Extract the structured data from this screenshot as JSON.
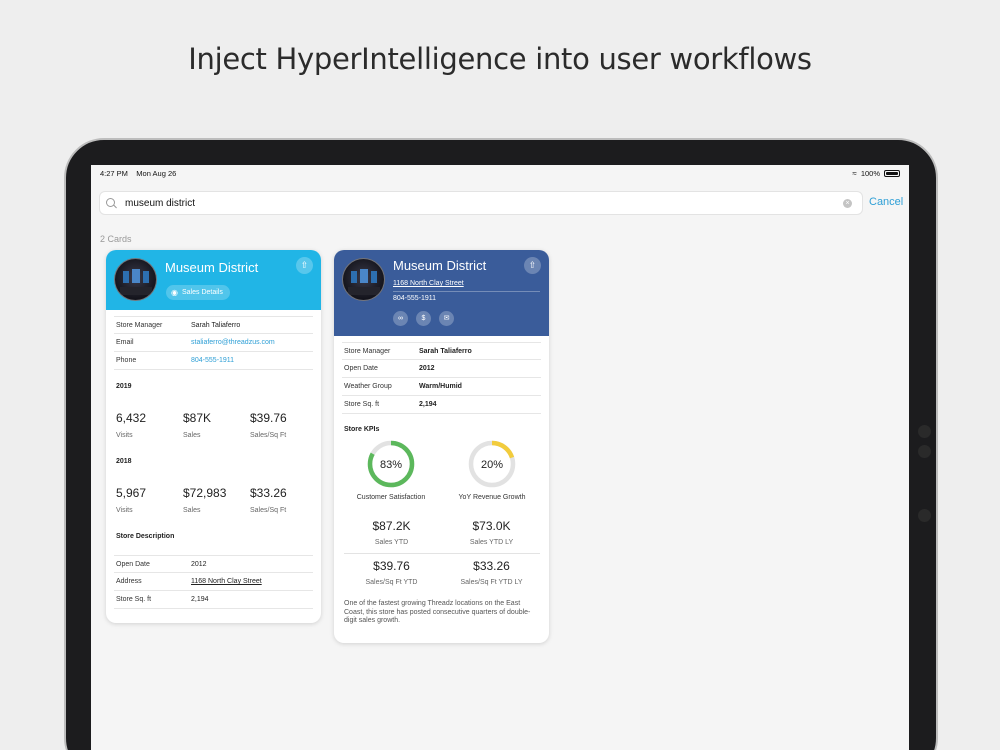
{
  "headline": "Inject HyperIntelligence into user workflows",
  "status": {
    "time": "4:27 PM",
    "date": "Mon Aug 26",
    "battery": "100%"
  },
  "search": {
    "value": "museum district",
    "cancel": "Cancel"
  },
  "results_count": "2 Cards",
  "card1": {
    "title": "Museum District",
    "pill": "Sales Details",
    "info": [
      {
        "k": "Store Manager",
        "v": "Sarah Taliaferro"
      },
      {
        "k": "Email",
        "v": "staliaferro@threadzus.com"
      },
      {
        "k": "Phone",
        "v": "804-555-1911"
      }
    ],
    "year1": "2019",
    "y1": [
      {
        "v": "6,432",
        "l": "Visits"
      },
      {
        "v": "$87K",
        "l": "Sales"
      },
      {
        "v": "$39.76",
        "l": "Sales/Sq Ft"
      }
    ],
    "year2": "2018",
    "y2": [
      {
        "v": "5,967",
        "l": "Visits"
      },
      {
        "v": "$72,983",
        "l": "Sales"
      },
      {
        "v": "$33.26",
        "l": "Sales/Sq Ft"
      }
    ],
    "desc_title": "Store Description",
    "details": [
      {
        "k": "Open Date",
        "v": "2012"
      },
      {
        "k": "Address",
        "v": "1168 North Clay Street"
      },
      {
        "k": "Store Sq. ft",
        "v": "2,194"
      }
    ]
  },
  "card2": {
    "title": "Museum District",
    "address": "1168 North Clay Street",
    "phone": "804-555-1911",
    "icons": [
      "link-icon",
      "dollar-icon",
      "mail-icon"
    ],
    "info": [
      {
        "k": "Store Manager",
        "v": "Sarah Taliaferro"
      },
      {
        "k": "Open Date",
        "v": "2012"
      },
      {
        "k": "Weather Group",
        "v": "Warm/Humid"
      },
      {
        "k": "Store Sq. ft",
        "v": "2,194"
      }
    ],
    "kpi_title": "Store KPIs",
    "donuts": [
      {
        "value": 83,
        "label": "83%",
        "caption": "Customer Satisfaction",
        "color": "#5cb85c"
      },
      {
        "value": 20,
        "label": "20%",
        "caption": "YoY Revenue Growth",
        "color": "#f2cc3d"
      }
    ],
    "kpis": [
      {
        "v": "$87.2K",
        "l": "Sales YTD"
      },
      {
        "v": "$73.0K",
        "l": "Sales YTD LY"
      },
      {
        "v": "$39.76",
        "l": "Sales/Sq Ft YTD"
      },
      {
        "v": "$33.26",
        "l": "Sales/Sq Ft YTD LY"
      }
    ],
    "description": "One of the fastest growing Threadz locations on the East Coast, this store has posted consecutive quarters of double-digit sales growth."
  }
}
